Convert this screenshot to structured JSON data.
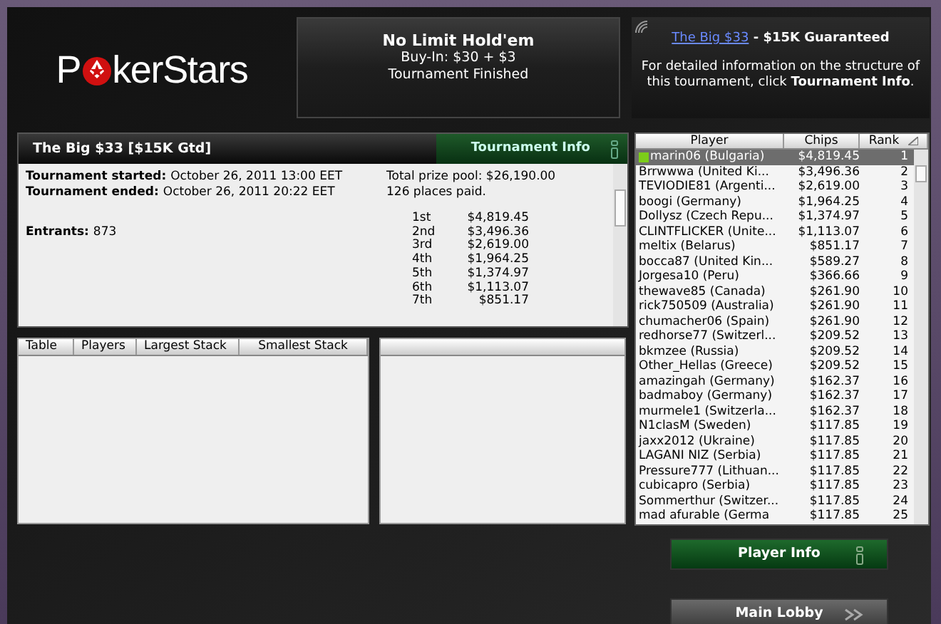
{
  "logo": {
    "text_before": "P",
    "text_after": "kerStars"
  },
  "header": {
    "game": "No Limit Hold'em",
    "buy_in": "Buy-In: $30 + $3",
    "status": "Tournament Finished"
  },
  "info_box": {
    "link": "The Big $33",
    "guarantee": " - $15K Guaranteed",
    "description": "For detailed information on the structure of this tournament, click **Tournament Info**."
  },
  "tournament": {
    "title": "The Big $33 [$15K Gtd]",
    "info_button": "Tournament Info",
    "details": [
      {
        "label": "Tournament started:",
        "value": "October 26, 2011 13:00 EET"
      },
      {
        "label": "Tournament ended:",
        "value": "October 26, 2011 20:22 EET"
      },
      {
        "label": "Entrants:",
        "value": "873"
      }
    ],
    "prize_pool": "Total prize pool: $26,190.00",
    "places_paid": "126 places paid.",
    "payouts": [
      {
        "place": "1st",
        "amount": "$4,819.45"
      },
      {
        "place": "2nd",
        "amount": "$3,496.36"
      },
      {
        "place": "3rd",
        "amount": "$2,619.00"
      },
      {
        "place": "4th",
        "amount": "$1,964.25"
      },
      {
        "place": "5th",
        "amount": "$1,374.97"
      },
      {
        "place": "6th",
        "amount": "$1,113.07"
      },
      {
        "place": "7th",
        "amount": "$851.17"
      }
    ]
  },
  "tables": {
    "columns": [
      "Table",
      "Players",
      "Largest Stack",
      "Smallest Stack"
    ]
  },
  "players": {
    "columns": [
      {
        "label": "Player",
        "sorted": false
      },
      {
        "label": "Chips",
        "sorted": false
      },
      {
        "label": "Rank",
        "sorted": true
      }
    ],
    "rows": [
      {
        "player": "marin06 (Bulgaria)",
        "chips": "$4,819.45",
        "rank": "1",
        "selected": true,
        "marker": true
      },
      {
        "player": "Brrwwwa (United Ki...",
        "chips": "$3,496.36",
        "rank": "2",
        "selected": false,
        "marker": false
      },
      {
        "player": "TEVIODIE81 (Argenti...",
        "chips": "$2,619.00",
        "rank": "3",
        "selected": false,
        "marker": false
      },
      {
        "player": "boogi (Germany)",
        "chips": "$1,964.25",
        "rank": "4",
        "selected": false,
        "marker": false
      },
      {
        "player": "Dollysz (Czech Repu...",
        "chips": "$1,374.97",
        "rank": "5",
        "selected": false,
        "marker": false
      },
      {
        "player": "CLINTFLICKER (Unite...",
        "chips": "$1,113.07",
        "rank": "6",
        "selected": false,
        "marker": false
      },
      {
        "player": "meltix (Belarus)",
        "chips": "$851.17",
        "rank": "7",
        "selected": false,
        "marker": false
      },
      {
        "player": "bocca87 (United Kin...",
        "chips": "$589.27",
        "rank": "8",
        "selected": false,
        "marker": false
      },
      {
        "player": "Jorgesa10 (Peru)",
        "chips": "$366.66",
        "rank": "9",
        "selected": false,
        "marker": false
      },
      {
        "player": "thewave85 (Canada)",
        "chips": "$261.90",
        "rank": "10",
        "selected": false,
        "marker": false
      },
      {
        "player": "rick750509 (Australia)",
        "chips": "$261.90",
        "rank": "11",
        "selected": false,
        "marker": false
      },
      {
        "player": "chumacher06 (Spain)",
        "chips": "$261.90",
        "rank": "12",
        "selected": false,
        "marker": false
      },
      {
        "player": "redhorse77 (Switzerl...",
        "chips": "$209.52",
        "rank": "13",
        "selected": false,
        "marker": false
      },
      {
        "player": "bkmzee (Russia)",
        "chips": "$209.52",
        "rank": "14",
        "selected": false,
        "marker": false
      },
      {
        "player": "Other_Hellas (Greece)",
        "chips": "$209.52",
        "rank": "15",
        "selected": false,
        "marker": false
      },
      {
        "player": "amazingah (Germany)",
        "chips": "$162.37",
        "rank": "16",
        "selected": false,
        "marker": false
      },
      {
        "player": "badmaboy (Germany)",
        "chips": "$162.37",
        "rank": "17",
        "selected": false,
        "marker": false
      },
      {
        "player": "murmele1 (Switzerla...",
        "chips": "$162.37",
        "rank": "18",
        "selected": false,
        "marker": false
      },
      {
        "player": "N1clasM (Sweden)",
        "chips": "$117.85",
        "rank": "19",
        "selected": false,
        "marker": false
      },
      {
        "player": "jaxx2012 (Ukraine)",
        "chips": "$117.85",
        "rank": "20",
        "selected": false,
        "marker": false
      },
      {
        "player": "LAGANI NIZ (Serbia)",
        "chips": "$117.85",
        "rank": "21",
        "selected": false,
        "marker": false
      },
      {
        "player": "Pressure777 (Lithuan...",
        "chips": "$117.85",
        "rank": "22",
        "selected": false,
        "marker": false
      },
      {
        "player": "cubicapro (Serbia)",
        "chips": "$117.85",
        "rank": "23",
        "selected": false,
        "marker": false
      },
      {
        "player": "Sommerthur (Switzer...",
        "chips": "$117.85",
        "rank": "24",
        "selected": false,
        "marker": false
      },
      {
        "player": "mad afurable (Germa",
        "chips": "$117.85",
        "rank": "25",
        "selected": false,
        "marker": false
      }
    ]
  },
  "buttons": [
    {
      "label": "Player Info",
      "kind": "info"
    },
    {
      "label": "Main Lobby",
      "kind": "forward"
    }
  ]
}
